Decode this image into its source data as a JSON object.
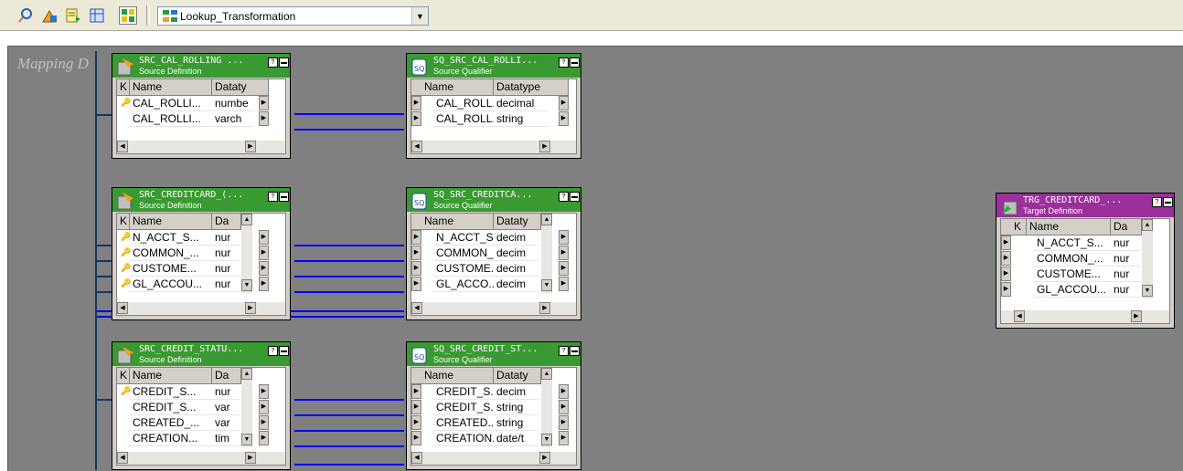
{
  "toolbar": {
    "buttons": [
      {
        "icon": "find-icon"
      },
      {
        "icon": "arrange-icon"
      },
      {
        "icon": "iconize-icon"
      },
      {
        "icon": "normal-view-icon"
      },
      {
        "icon": "links-view-icon"
      }
    ],
    "mapping_select": {
      "value": "Lookup_Transformation",
      "icon": "mapping-icon"
    }
  },
  "canvas": {
    "label": "Mapping D"
  },
  "objects": {
    "src_cal": {
      "title": "SRC_CAL_ROLLING ...",
      "subtitle": "Source Definition",
      "columns": [
        "K",
        "Name",
        "Dataty"
      ],
      "rows": [
        {
          "name": "CAL_ROLLI...",
          "type": "numbe"
        },
        {
          "name": "CAL_ROLLI...",
          "type": "varch"
        }
      ]
    },
    "sq_cal": {
      "title": "SQ_SRC_CAL_ROLLI...",
      "subtitle": "Source Qualifier",
      "columns": [
        "Name",
        "Datatype"
      ],
      "rows": [
        {
          "name": "CAL_ROLL...",
          "type": "decimal"
        },
        {
          "name": "CAL_ROLL...",
          "type": "string"
        }
      ]
    },
    "src_cc": {
      "title": "SRC_CREDITCARD_(...",
      "subtitle": "Source Definition",
      "columns": [
        "K",
        "Name",
        "Da"
      ],
      "rows": [
        {
          "name": "N_ACCT_S...",
          "type": "nur"
        },
        {
          "name": "COMMON_...",
          "type": "nur"
        },
        {
          "name": "CUSTOME...",
          "type": "nur"
        },
        {
          "name": "GL_ACCOU...",
          "type": "nur"
        }
      ]
    },
    "sq_cc": {
      "title": "SQ_SRC_CREDITCA...",
      "subtitle": "Source Qualifier",
      "columns": [
        "Name",
        "Dataty"
      ],
      "rows": [
        {
          "name": "N_ACCT_S...",
          "type": "decim"
        },
        {
          "name": "COMMON_...",
          "type": "decim"
        },
        {
          "name": "CUSTOME...",
          "type": "decim"
        },
        {
          "name": "GL_ACCO...",
          "type": "decim"
        }
      ]
    },
    "src_cs": {
      "title": "SRC_CREDIT_STATU...",
      "subtitle": "Source Definition",
      "columns": [
        "K",
        "Name",
        "Da"
      ],
      "rows": [
        {
          "name": "CREDIT_S...",
          "type": "nur"
        },
        {
          "name": "CREDIT_S...",
          "type": "var"
        },
        {
          "name": "CREATED_...",
          "type": "var"
        },
        {
          "name": "CREATION...",
          "type": "tim"
        }
      ]
    },
    "sq_cs": {
      "title": "SQ_SRC_CREDIT_ST...",
      "subtitle": "Source Qualifier",
      "columns": [
        "Name",
        "Dataty"
      ],
      "rows": [
        {
          "name": "CREDIT_S...",
          "type": "decim"
        },
        {
          "name": "CREDIT_S...",
          "type": "string"
        },
        {
          "name": "CREATED...",
          "type": "string"
        },
        {
          "name": "CREATION...",
          "type": "date/t"
        }
      ]
    },
    "trg_cc": {
      "title": "TRG_CREDITCARD_...",
      "subtitle": "Target Definition",
      "columns": [
        "K",
        "Name",
        "Da"
      ],
      "rows": [
        {
          "name": "N_ACCT_S...",
          "type": "nur"
        },
        {
          "name": "COMMON_...",
          "type": "nur"
        },
        {
          "name": "CUSTOME...",
          "type": "nur"
        },
        {
          "name": "GL_ACCOU...",
          "type": "nur"
        }
      ]
    }
  },
  "colors": {
    "source_header": "#3a9a32",
    "target_header": "#9b2f9b",
    "link": "#0000ff",
    "canvas": "#808080"
  }
}
